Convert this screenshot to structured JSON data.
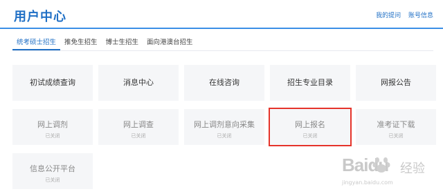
{
  "header": {
    "title": "用户中心",
    "links": [
      "我的提问",
      "账号信息"
    ]
  },
  "tabs": [
    "统考硕士招生",
    "推免生招生",
    "博士生招生",
    "面向港澳台招生"
  ],
  "active_tab": 0,
  "status_closed": "已关闭",
  "cards": [
    {
      "label": "初试成绩查询",
      "state": "active"
    },
    {
      "label": "消息中心",
      "state": "active"
    },
    {
      "label": "在线咨询",
      "state": "active"
    },
    {
      "label": "招生专业目录",
      "state": "active"
    },
    {
      "label": "网报公告",
      "state": "active"
    },
    {
      "label": "网上调剂",
      "state": "closed",
      "status": "已关闭"
    },
    {
      "label": "网上调查",
      "state": "closed",
      "status": "已关闭"
    },
    {
      "label": "网上调剂意向采集",
      "state": "closed",
      "status": "已关闭"
    },
    {
      "label": "网上报名",
      "state": "closed",
      "status": "已关闭",
      "highlighted": true
    },
    {
      "label": "准考证下载",
      "state": "closed",
      "status": "已关闭"
    },
    {
      "label": "信息公开平台",
      "state": "closed",
      "status": "已关闭"
    }
  ],
  "watermark": {
    "logo": "Baidu",
    "logo_cn": "经验",
    "url": "jingyan.baidu.com"
  },
  "colors": {
    "accent": "#1f6fc5",
    "header_line": "#3a8ee6",
    "card_bg": "#f5f6f8",
    "highlight": "#e5332a"
  }
}
